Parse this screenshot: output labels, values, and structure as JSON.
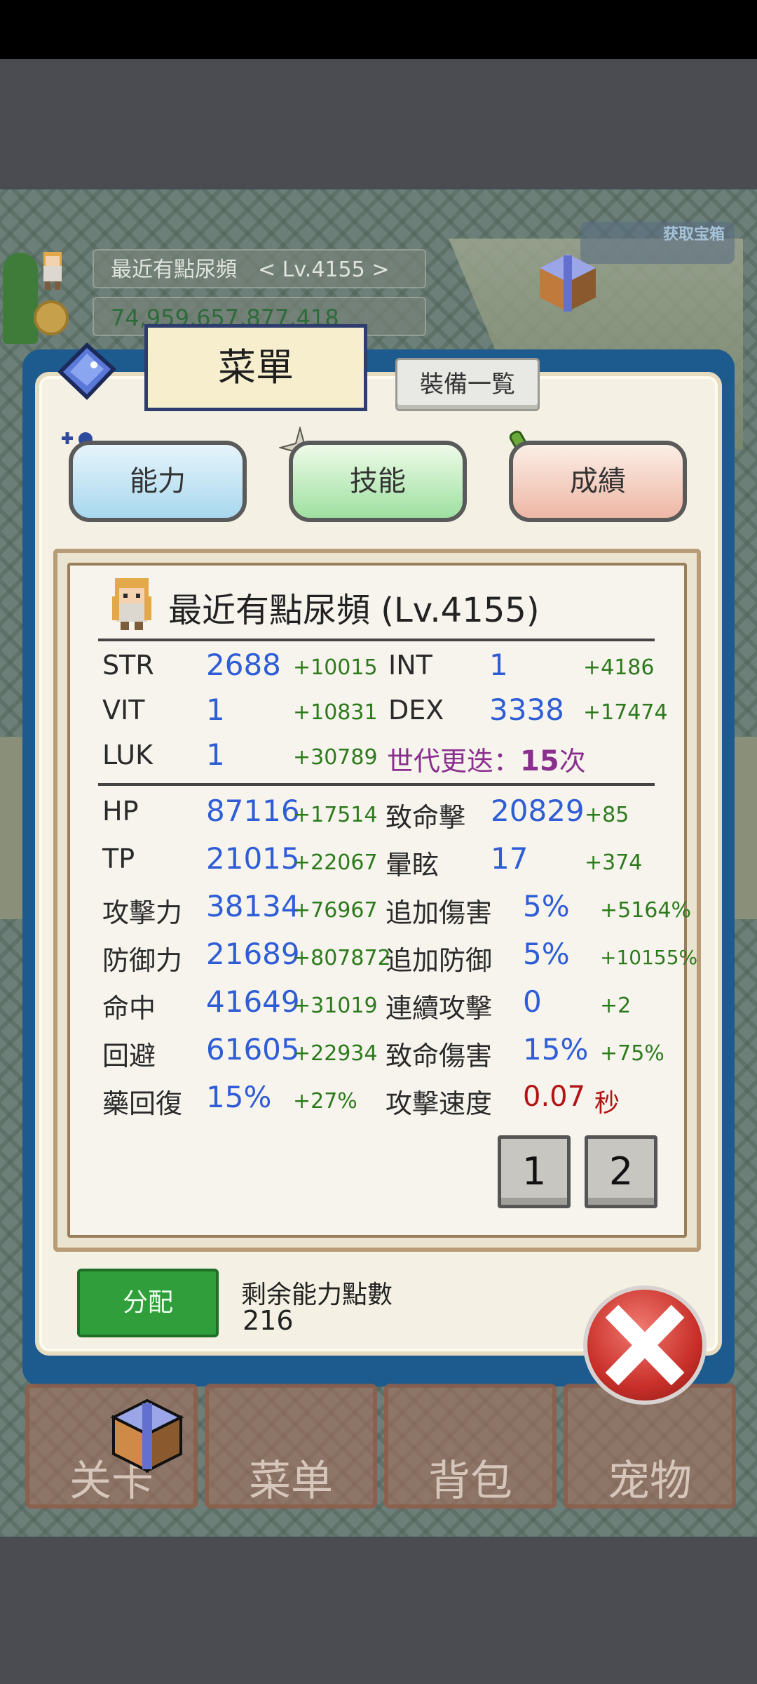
{
  "hud": {
    "player_name": "最近有點尿頻　< Lv.4155 >",
    "gold": "74,959,657,877,418",
    "get_gift": "获取宝箱"
  },
  "menu": {
    "title": "菜單",
    "equip_list": "裝備一覧",
    "categories": [
      "能力",
      "技能",
      "成績"
    ]
  },
  "character": {
    "title": "最近有點尿頻 (Lv.4155)"
  },
  "base_stats": [
    {
      "label": "STR",
      "value": "2688",
      "bonus": "+10015"
    },
    {
      "label": "INT",
      "value": "1",
      "bonus": "+4186"
    },
    {
      "label": "VIT",
      "value": "1",
      "bonus": "+10831"
    },
    {
      "label": "DEX",
      "value": "3338",
      "bonus": "+17474"
    },
    {
      "label": "LUK",
      "value": "1",
      "bonus": "+30789"
    }
  ],
  "generation": {
    "prefix": "世代更迭：",
    "count": "15",
    "suffix": "次"
  },
  "combat_left": [
    {
      "label": "HP",
      "value": "87116",
      "bonus": "+17514"
    },
    {
      "label": "TP",
      "value": "21015",
      "bonus": "+22067"
    },
    {
      "label": "攻擊力",
      "value": "38134",
      "bonus": "+76967"
    },
    {
      "label": "防御力",
      "value": "21689",
      "bonus": "+807872"
    },
    {
      "label": "命中",
      "value": "41649",
      "bonus": "+31019"
    },
    {
      "label": "回避",
      "value": "61605",
      "bonus": "+22934"
    },
    {
      "label": "藥回復",
      "value": "15%",
      "bonus": "+27%"
    }
  ],
  "combat_right": [
    {
      "label": "致命擊",
      "value": "20829",
      "bonus": "+85"
    },
    {
      "label": "暈眩",
      "value": "17",
      "bonus": "+374"
    },
    {
      "label": "追加傷害",
      "value": "5%",
      "bonus": "+5164%"
    },
    {
      "label": "追加防御",
      "value": "5%",
      "bonus": "+10155%"
    },
    {
      "label": "連續攻擊",
      "value": "0",
      "bonus": "+2"
    },
    {
      "label": "致命傷害",
      "value": "15%",
      "bonus": "+75%"
    },
    {
      "label": "攻擊速度",
      "value": "0.07",
      "unit": "秒"
    }
  ],
  "pages": [
    "1",
    "2"
  ],
  "assign": {
    "button": "分配",
    "remaining_label": "剩余能力點數",
    "remaining_value": "216"
  },
  "nav": [
    "关卡",
    "菜单",
    "背包",
    "宠物"
  ],
  "icons": {
    "close": "close-icon",
    "book": "book-icon",
    "ability": "add-user-icon",
    "skill": "sparkle-icon",
    "record": "scroll-icon",
    "gift": "gift-box-icon"
  },
  "colors": {
    "modal_border": "#1d5a8e",
    "stat_value": "#2f5dd6",
    "stat_bonus": "#2d7a1c",
    "generation": "#8b2f8f",
    "speed": "#b21414",
    "assign_button": "#2f9e3b"
  }
}
